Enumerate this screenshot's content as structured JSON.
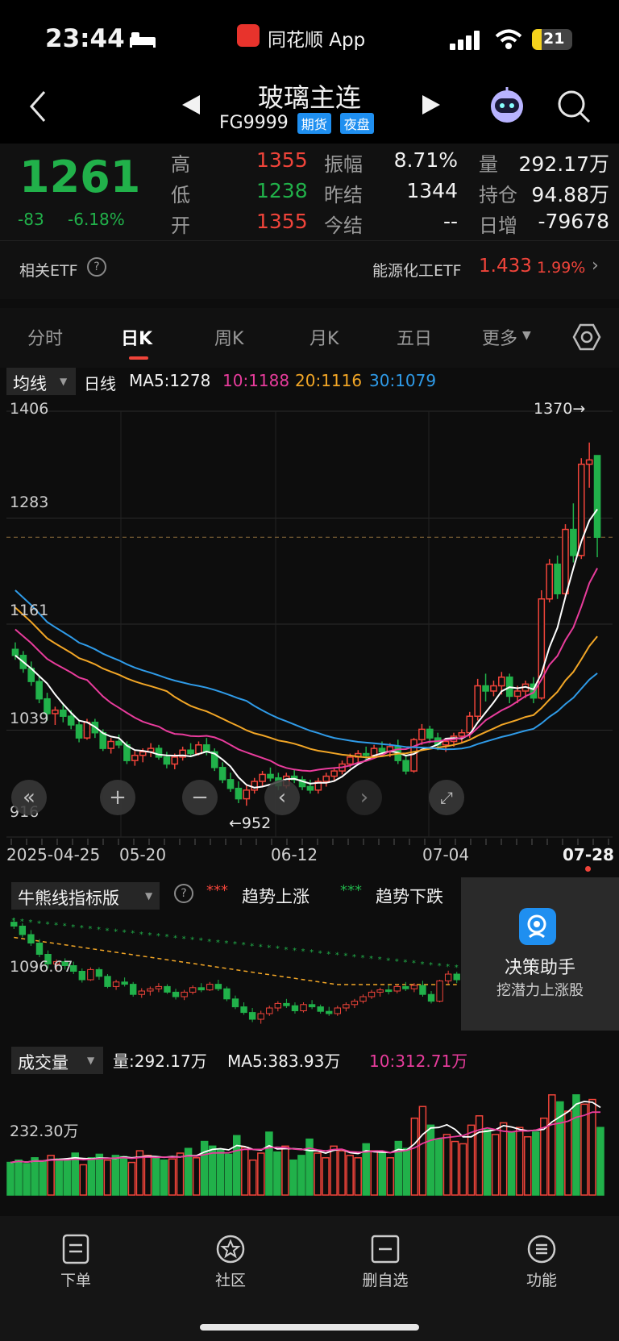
{
  "status_bar": {
    "time": "23:44",
    "app_name": "同花顺 App",
    "battery": "21"
  },
  "header": {
    "title": "玻璃主连",
    "code": "FG9999",
    "badges": [
      "期货",
      "夜盘"
    ]
  },
  "quote": {
    "price": "1261",
    "change": "-83",
    "change_pct": "-6.18%",
    "rows": [
      {
        "l1": "高",
        "v1": "1355",
        "l2": "振幅",
        "v2": "8.71%",
        "l3": "量",
        "v3": "292.17万"
      },
      {
        "l1": "低",
        "v1": "1238",
        "l2": "昨结",
        "v2": "1344",
        "l3": "持仓",
        "v3": "94.88万"
      },
      {
        "l1": "开",
        "v1": "1355",
        "l2": "今结",
        "v2": "--",
        "l3": "日增",
        "v3": "-79678"
      }
    ]
  },
  "etf": {
    "label": "相关ETF",
    "name": "能源化工ETF",
    "price": "1.433",
    "pct": "1.99%"
  },
  "tabs": [
    "分时",
    "日K",
    "周K",
    "月K",
    "五日",
    "更多"
  ],
  "kline_legend": {
    "selector": "均线",
    "period": "日线",
    "ma5": "MA5:1278",
    "ma10": "10:1188",
    "ma20": "20:1116",
    "ma30": "30:1079"
  },
  "colors": {
    "up": "#f0443a",
    "down": "#21b14a",
    "ma5": "#ffffff",
    "ma10": "#e83c9c",
    "ma20": "#f2a626",
    "ma30": "#2f9be8"
  },
  "chart_data": [
    {
      "type": "candlestick",
      "y_ticks": [
        "1406",
        "1283",
        "1161",
        "1039",
        "916"
      ],
      "ylim": [
        916,
        1406
      ],
      "x_labels": [
        "2025-04-25",
        "05-20",
        "06-12",
        "07-04",
        "07-28"
      ],
      "annotations": {
        "high": "1370→",
        "low": "←952"
      },
      "candles": [
        [
          1132,
          1140,
          1120,
          1125
        ],
        [
          1125,
          1130,
          1105,
          1110
        ],
        [
          1110,
          1118,
          1090,
          1095
        ],
        [
          1095,
          1102,
          1070,
          1075
        ],
        [
          1075,
          1082,
          1050,
          1058
        ],
        [
          1058,
          1066,
          1045,
          1062
        ],
        [
          1062,
          1068,
          1048,
          1055
        ],
        [
          1055,
          1062,
          1040,
          1045
        ],
        [
          1045,
          1050,
          1025,
          1030
        ],
        [
          1030,
          1052,
          1028,
          1048
        ],
        [
          1048,
          1052,
          1030,
          1036
        ],
        [
          1036,
          1040,
          1015,
          1018
        ],
        [
          1018,
          1030,
          1012,
          1026
        ],
        [
          1026,
          1034,
          1018,
          1022
        ],
        [
          1022,
          1026,
          1000,
          1004
        ],
        [
          1004,
          1015,
          998,
          1010
        ],
        [
          1010,
          1018,
          1002,
          1014
        ],
        [
          1014,
          1024,
          1008,
          1018
        ],
        [
          1018,
          1022,
          1005,
          1008
        ],
        [
          1008,
          1014,
          995,
          1000
        ],
        [
          1000,
          1012,
          994,
          1008
        ],
        [
          1008,
          1020,
          1004,
          1016
        ],
        [
          1016,
          1024,
          1008,
          1012
        ],
        [
          1012,
          1026,
          1010,
          1022
        ],
        [
          1022,
          1030,
          1010,
          1014
        ],
        [
          1014,
          1018,
          992,
          996
        ],
        [
          996,
          1002,
          978,
          982
        ],
        [
          982,
          990,
          968,
          972
        ],
        [
          972,
          980,
          955,
          960
        ],
        [
          960,
          975,
          952,
          970
        ],
        [
          970,
          984,
          966,
          980
        ],
        [
          980,
          992,
          974,
          988
        ],
        [
          988,
          996,
          980,
          984
        ],
        [
          984,
          990,
          970,
          975
        ],
        [
          975,
          990,
          972,
          986
        ],
        [
          986,
          994,
          978,
          982
        ],
        [
          982,
          986,
          970,
          974
        ],
        [
          974,
          982,
          966,
          970
        ],
        [
          970,
          984,
          966,
          980
        ],
        [
          980,
          990,
          974,
          986
        ],
        [
          986,
          996,
          980,
          992
        ],
        [
          992,
          1004,
          988,
          1000
        ],
        [
          1000,
          1012,
          996,
          1008
        ],
        [
          1008,
          1016,
          1000,
          1012
        ],
        [
          1012,
          1020,
          1004,
          1010
        ],
        [
          1010,
          1022,
          1006,
          1018
        ],
        [
          1018,
          1026,
          1010,
          1014
        ],
        [
          1014,
          1024,
          1008,
          1020
        ],
        [
          1020,
          1028,
          1000,
          1004
        ],
        [
          1004,
          1010,
          988,
          992
        ],
        [
          992,
          1030,
          990,
          1028
        ],
        [
          1028,
          1046,
          1022,
          1040
        ],
        [
          1040,
          1044,
          1024,
          1030
        ],
        [
          1030,
          1036,
          1016,
          1022
        ],
        [
          1022,
          1030,
          1014,
          1026
        ],
        [
          1026,
          1036,
          1020,
          1032
        ],
        [
          1032,
          1040,
          1024,
          1036
        ],
        [
          1036,
          1060,
          1030,
          1055
        ],
        [
          1055,
          1098,
          1050,
          1090
        ],
        [
          1090,
          1104,
          1072,
          1084
        ],
        [
          1084,
          1096,
          1078,
          1090
        ],
        [
          1090,
          1106,
          1080,
          1100
        ],
        [
          1100,
          1104,
          1070,
          1078
        ],
        [
          1078,
          1090,
          1070,
          1084
        ],
        [
          1084,
          1096,
          1076,
          1092
        ],
        [
          1092,
          1100,
          1070,
          1076
        ],
        [
          1076,
          1200,
          1074,
          1190
        ],
        [
          1190,
          1236,
          1186,
          1230
        ],
        [
          1230,
          1240,
          1190,
          1196
        ],
        [
          1196,
          1276,
          1192,
          1270
        ],
        [
          1270,
          1300,
          1232,
          1240
        ],
        [
          1240,
          1352,
          1236,
          1345
        ],
        [
          1345,
          1370,
          1318,
          1350
        ],
        [
          1355,
          1355,
          1238,
          1261
        ]
      ]
    },
    {
      "type": "indicator",
      "title": "牛熊线指标版",
      "legend": [
        {
          "name": "趋势上涨"
        },
        {
          "name": "趋势下跌"
        }
      ],
      "y_tick": "1096.67"
    },
    {
      "type": "bar",
      "title": "成交量",
      "legend": {
        "vol": "量:292.17万",
        "ma5": "MA5:383.93万",
        "ma10": "10:312.71万"
      },
      "y_tick": "232.30万",
      "values": [
        140,
        150,
        135,
        160,
        145,
        170,
        155,
        150,
        180,
        130,
        160,
        175,
        150,
        170,
        165,
        140,
        190,
        170,
        160,
        150,
        155,
        180,
        200,
        160,
        230,
        210,
        195,
        175,
        255,
        205,
        150,
        180,
        270,
        185,
        210,
        150,
        170,
        240,
        180,
        160,
        210,
        190,
        170,
        160,
        220,
        190,
        180,
        160,
        230,
        200,
        330,
        380,
        300,
        240,
        260,
        230,
        220,
        300,
        340,
        280,
        260,
        310,
        270,
        290,
        250,
        270,
        330,
        430,
        400,
        360,
        430,
        390,
        410,
        290
      ]
    }
  ],
  "promo": {
    "title": "决策助手",
    "subtitle": "挖潜力上涨股"
  },
  "nav": [
    "下单",
    "社区",
    "删自选",
    "功能"
  ]
}
